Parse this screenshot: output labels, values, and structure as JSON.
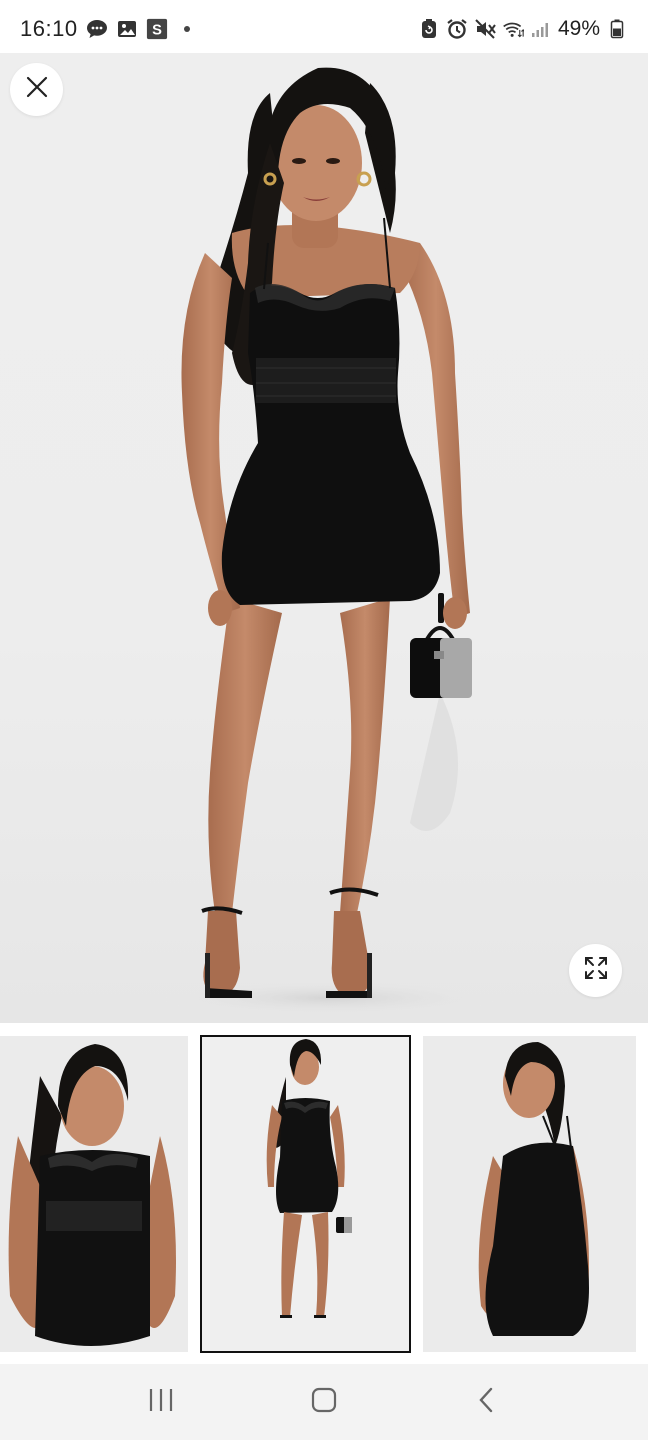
{
  "status_bar": {
    "time": "16:10",
    "battery": "49%",
    "left_icons": [
      "chat-bubble-icon",
      "gallery-icon",
      "s-app-icon",
      "dot-icon"
    ],
    "right_icons": [
      "recycle-icon",
      "alarm-icon",
      "mute-icon",
      "wifi-icon",
      "signal-icon",
      "battery-icon"
    ]
  },
  "product_viewer": {
    "main_image": "model-black-mini-dress-front",
    "close_icon": "close-icon",
    "expand_icon": "expand-icon",
    "thumbnails": [
      {
        "name": "thumbnail-closeup-front",
        "selected": false
      },
      {
        "name": "thumbnail-full-front",
        "selected": true
      },
      {
        "name": "thumbnail-back",
        "selected": false
      }
    ]
  },
  "nav_bar": {
    "buttons": [
      "recent-apps-icon",
      "home-icon",
      "back-icon"
    ]
  },
  "colors": {
    "background": "#ffffff",
    "image_bg": "#eeeeee",
    "dress": "#111111",
    "skin": "#b5785a",
    "hair": "#141210",
    "selected_border": "#111111",
    "nav_bg": "#f3f3f3"
  }
}
